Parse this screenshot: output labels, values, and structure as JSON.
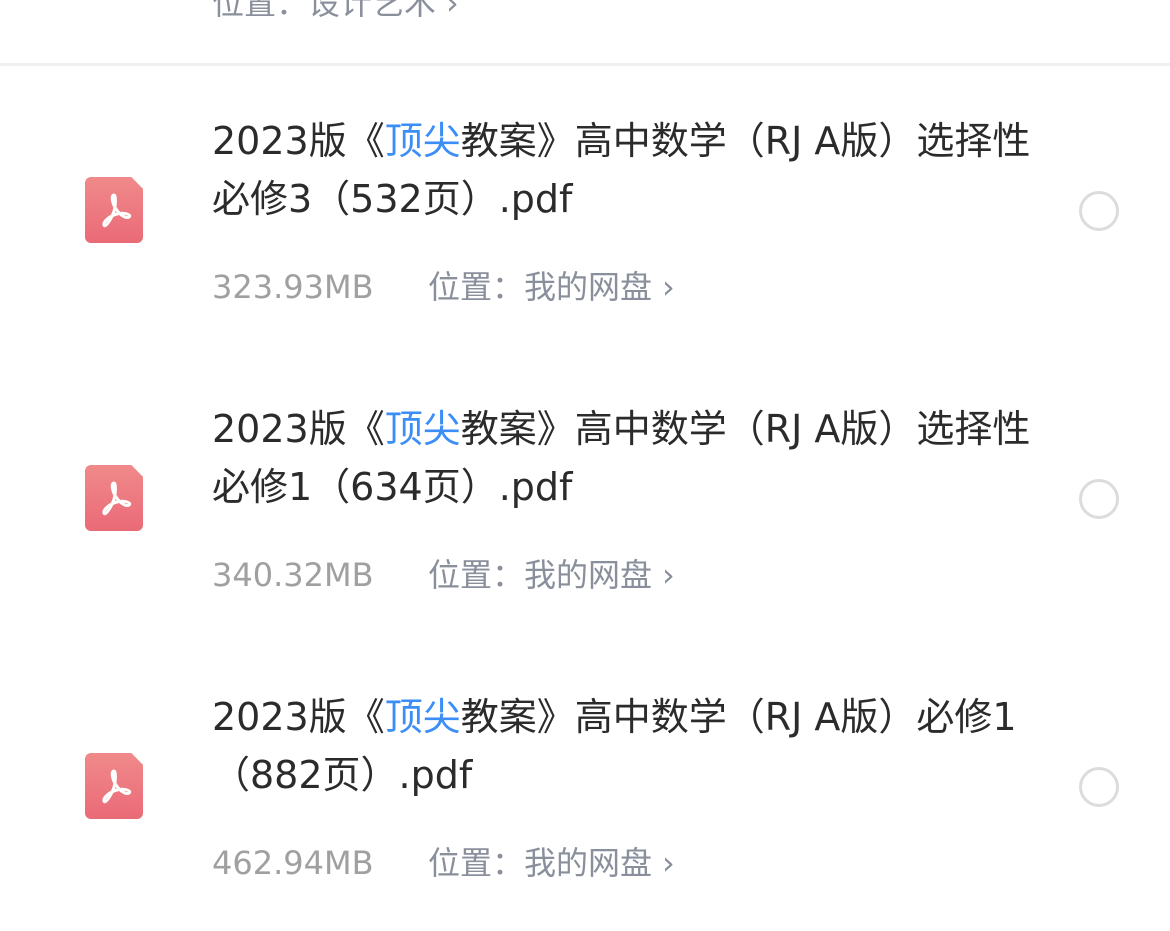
{
  "previous_item": {
    "location": "位置：设计艺术",
    "chevron": "›"
  },
  "files": [
    {
      "title_prefix": "2023版《",
      "title_highlight": "顶尖",
      "title_suffix": "教案》高中数学（RJ A版）选择性必修3（532页）.pdf",
      "size": "323.93MB",
      "location": "位置：我的网盘",
      "icon": "pdf-icon",
      "selected": false
    },
    {
      "title_prefix": "2023版《",
      "title_highlight": "顶尖",
      "title_suffix": "教案》高中数学（RJ A版）选择性必修1（634页）.pdf",
      "size": "340.32MB",
      "location": "位置：我的网盘",
      "icon": "pdf-icon",
      "selected": false
    },
    {
      "title_prefix": "2023版《",
      "title_highlight": "顶尖",
      "title_suffix": "教案》高中数学（RJ A版）必修1（882页）.pdf",
      "size": "462.94MB",
      "location": "位置：我的网盘",
      "icon": "pdf-icon",
      "selected": false
    }
  ],
  "colors": {
    "highlight": "#3a8ef6",
    "pdf_icon": "#ea6a78"
  }
}
